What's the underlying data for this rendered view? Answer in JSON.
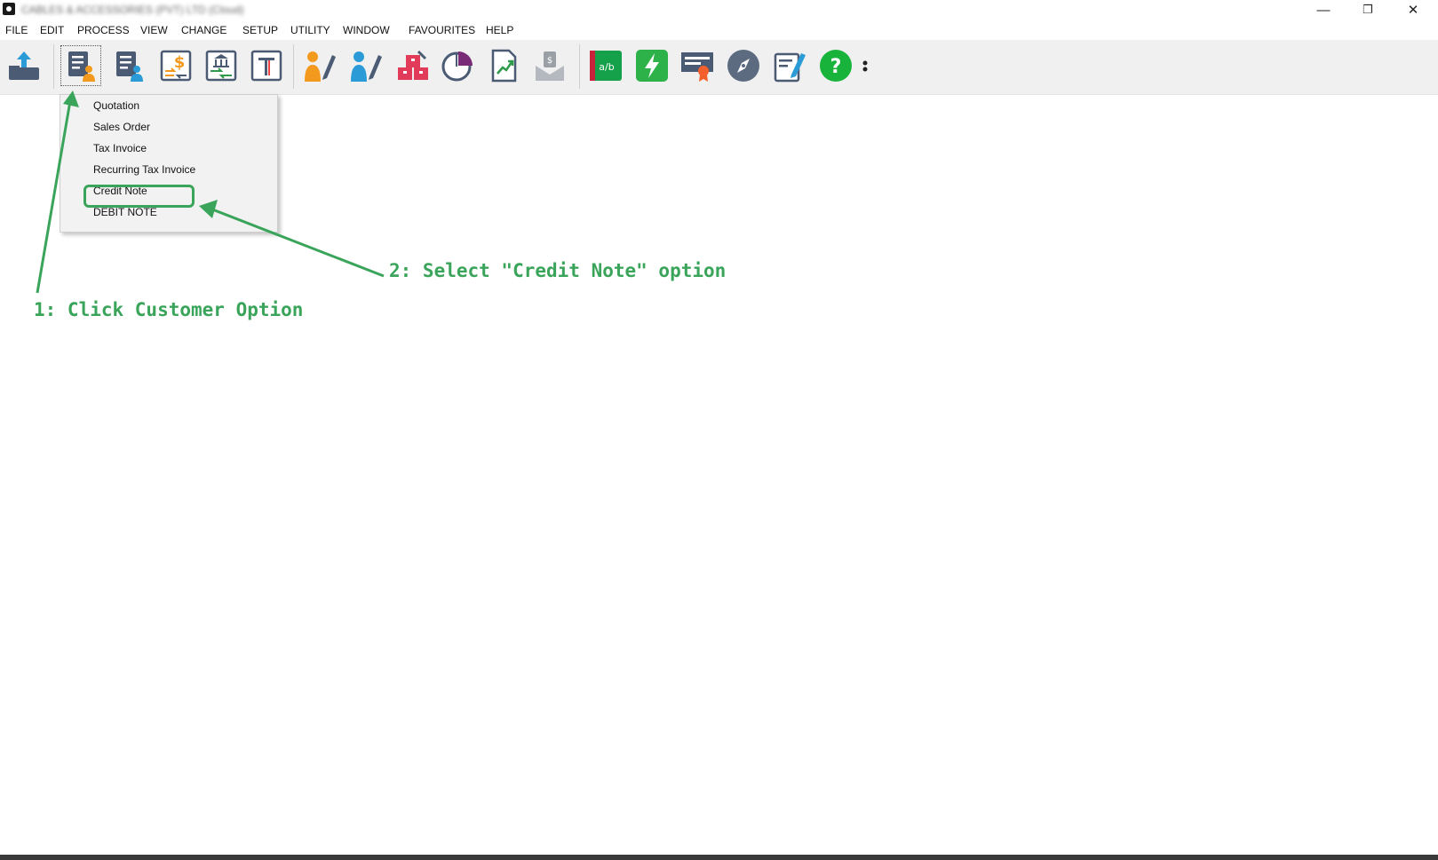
{
  "window": {
    "title": "CABLES & ACCESSORIES (PVT) LTD (Cloud)",
    "controls": {
      "minimize": "—",
      "restore": "❐",
      "close": "✕"
    }
  },
  "menu": [
    "FILE",
    "EDIT",
    "PROCESS",
    "VIEW",
    "CHANGE",
    "SETUP",
    "UTILITY",
    "WINDOW",
    "FAVOURITES",
    "HELP"
  ],
  "toolbar": {
    "icons": [
      "export-tray-icon",
      "customer-icon",
      "supplier-icon",
      "payment-exchange-icon",
      "bank-transfer-icon",
      "text-template-icon",
      "edit-customer-icon",
      "edit-supplier-icon",
      "inventory-icon",
      "pie-chart-icon",
      "trend-report-icon",
      "cash-envelope-icon",
      "green-report-icon",
      "flash-icon",
      "certificate-icon",
      "compass-icon",
      "notepad-icon",
      "help-icon"
    ],
    "selected": "customer-icon"
  },
  "dropdown": {
    "items": [
      "Quotation",
      "Sales Order",
      "Tax Invoice",
      "Recurring Tax Invoice",
      "Credit Note",
      "DEBIT NOTE"
    ],
    "highlighted": "Credit Note"
  },
  "annotations": {
    "step1": "1: Click Customer Option",
    "step2": "2: Select \"Credit Note\" option"
  },
  "colors": {
    "annotation": "#3aa55a",
    "toolbar_bg": "#f0f0f0",
    "menu_bg": "#f2f2f2"
  }
}
